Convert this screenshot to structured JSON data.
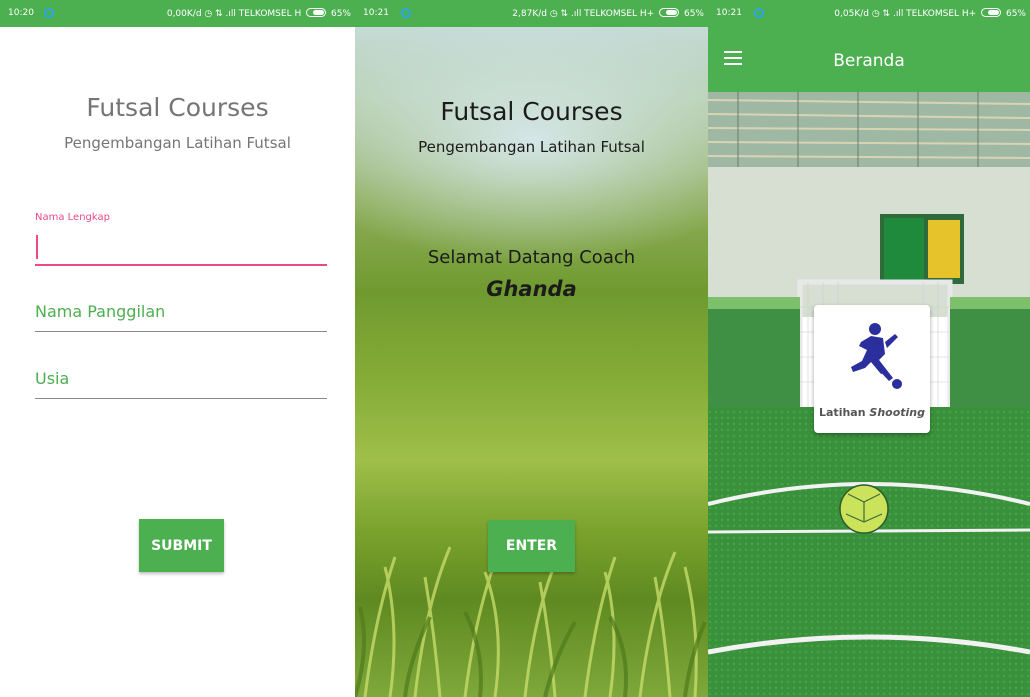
{
  "screens": [
    {
      "status": {
        "time": "10:20",
        "info": "0,00K/d ◷ ⇅ .ıll TELKOMSEL H",
        "battery": "65%"
      },
      "title": "Futsal Courses",
      "subtitle": "Pengembangan Latihan Futsal",
      "form": {
        "full_name_label": "Nama Lengkap",
        "full_name_value": "",
        "nickname_placeholder": "Nama Panggilan",
        "age_placeholder": "Usia"
      },
      "submit_label": "SUBMIT"
    },
    {
      "status": {
        "time": "10:21",
        "info": "2,87K/d ◷ ⇅ .ıll TELKOMSEL H+",
        "battery": "65%"
      },
      "title": "Futsal Courses",
      "subtitle": "Pengembangan Latihan Futsal",
      "welcome": "Selamat Datang Coach",
      "coach_name": "Ghanda",
      "enter_label": "ENTER"
    },
    {
      "status": {
        "time": "10:21",
        "info": "0,05K/d ◷ ⇅ .ıll TELKOMSEL H+",
        "battery": "65%"
      },
      "appbar_title": "Beranda",
      "card": {
        "label_plain": "Latihan",
        "label_italic": "Shooting",
        "icon": "soccer-kick-icon"
      }
    }
  ],
  "colors": {
    "primary": "#4caf50",
    "accent_pink": "#e94a8a",
    "text_grey": "#757575",
    "icon_blue": "#2b2f9e",
    "status_dot": "#2aa7e8"
  }
}
